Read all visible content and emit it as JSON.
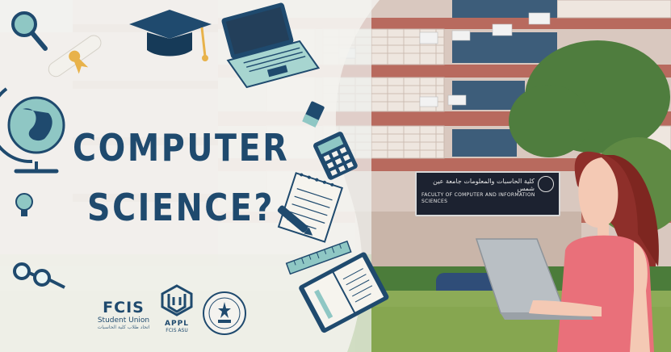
{
  "headline": {
    "line1": "COMPUTER",
    "line2": "SCIENCE?"
  },
  "logos": {
    "fcis_union": {
      "mark": "FCIS",
      "caption": "Student Union",
      "caption_ar": "اتحاد طلاب كلية الحاسبات"
    },
    "applied": {
      "name": "APPL",
      "caption": "FCIS ASU"
    },
    "seal_name": "ain-shams-university-seal"
  },
  "building_sign": {
    "arabic": "كلية الحاسبات والمعلومات جامعة عين شمس",
    "english": "FACULTY OF COMPUTER AND INFORMATION SCIENCES"
  },
  "colors": {
    "navy": "#1f4a6e",
    "paper": "#f3f1ec",
    "teal": "#8fc7c4",
    "brick": "#b86a5e",
    "dress": "#e9707a",
    "hair": "#8e2f2a",
    "skin": "#f4c9b4"
  },
  "icons": [
    "magnifier-icon",
    "graduation-cap-icon",
    "diploma-icon",
    "laptop-icon",
    "globe-icon",
    "pencil-icon",
    "calculator-icon",
    "notepad-icon",
    "pen-icon",
    "ruler-icon",
    "book-icon",
    "glasses-icon",
    "lightbulb-icon"
  ]
}
